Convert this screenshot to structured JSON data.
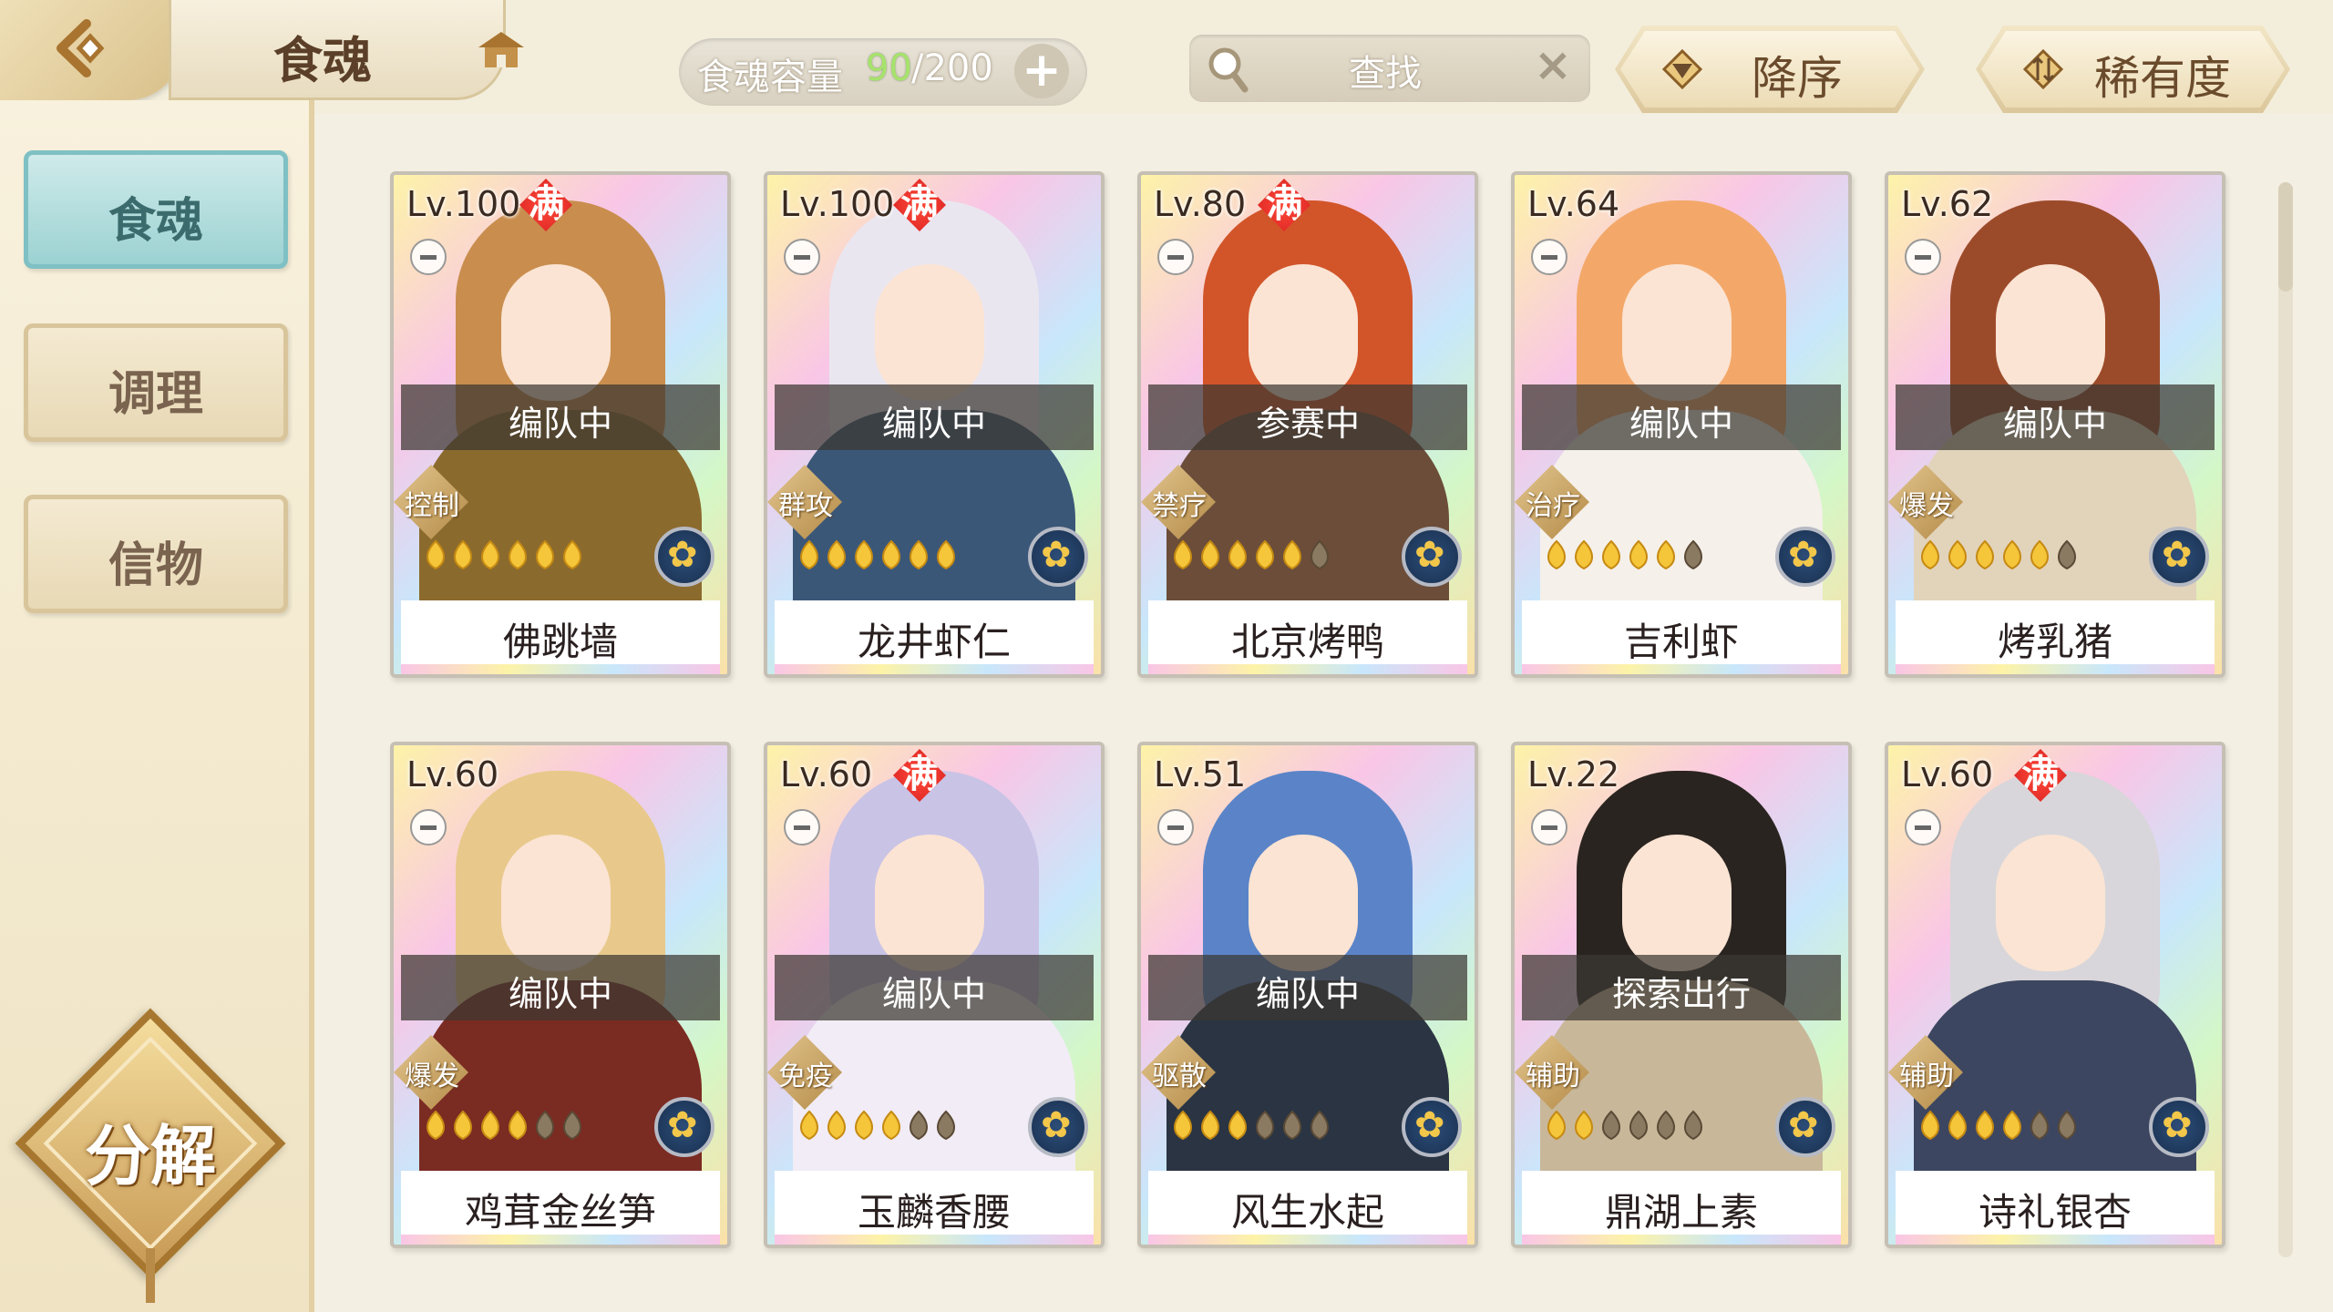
{
  "header": {
    "title": "食魂",
    "capacity_label": "食魂容量",
    "capacity_count": "90",
    "capacity_max": "/200",
    "capacity_add": "+",
    "search_placeholder": "查找",
    "search_clear": "×",
    "sort_order_label": "降序",
    "sort_field_label": "稀有度"
  },
  "sidebar": {
    "tabs": [
      {
        "label": "食魂",
        "active": true
      },
      {
        "label": "调理",
        "active": false
      },
      {
        "label": "信物",
        "active": false
      }
    ],
    "decompose_label": "分解"
  },
  "cards": [
    {
      "level": "Lv.100",
      "full": "满",
      "status": "编队中",
      "role": "控制",
      "stars": 6,
      "name": "佛跳墙",
      "hair": "#c98d4e",
      "robe": "#8b6a2e"
    },
    {
      "level": "Lv.100",
      "full": "满",
      "status": "编队中",
      "role": "群攻",
      "stars": 6,
      "name": "龙井虾仁",
      "hair": "#eae6f0",
      "robe": "#3b5778"
    },
    {
      "level": "Lv.80",
      "full": "满",
      "status": "参赛中",
      "role": "禁疗",
      "stars": 5,
      "name": "北京烤鸭",
      "hair": "#d2552a",
      "robe": "#6b4d3a"
    },
    {
      "level": "Lv.64",
      "full": "",
      "status": "编队中",
      "role": "治疗",
      "stars": 5,
      "name": "吉利虾",
      "hair": "#f3a86a",
      "robe": "#f5f0ea"
    },
    {
      "level": "Lv.62",
      "full": "",
      "status": "编队中",
      "role": "爆发",
      "stars": 5,
      "name": "烤乳猪",
      "hair": "#9c4b2a",
      "robe": "#e2d3bb"
    },
    {
      "level": "Lv.60",
      "full": "",
      "status": "编队中",
      "role": "爆发",
      "stars": 4,
      "name": "鸡茸金丝笋",
      "hair": "#e8c98b",
      "robe": "#7a2b22"
    },
    {
      "level": "Lv.60",
      "full": "满",
      "status": "编队中",
      "role": "免疫",
      "stars": 4,
      "name": "玉麟香腰",
      "hair": "#c9c3e6",
      "robe": "#f1ecf5"
    },
    {
      "level": "Lv.51",
      "full": "",
      "status": "编队中",
      "role": "驱散",
      "stars": 3,
      "name": "风生水起",
      "hair": "#5b84c8",
      "robe": "#2a3442"
    },
    {
      "level": "Lv.22",
      "full": "",
      "status": "探索出行",
      "role": "辅助",
      "stars": 2,
      "name": "鼎湖上素",
      "hair": "#2a2420",
      "robe": "#c9b79a"
    },
    {
      "level": "Lv.60",
      "full": "满",
      "status": "",
      "role": "辅助",
      "stars": 4,
      "name": "诗礼银杏",
      "hair": "#d8d6da",
      "robe": "#3d4660"
    }
  ],
  "colors": {
    "capacity_count": "#a6e36b",
    "active_tab": "#9cd2d2",
    "full_badge": "#d61f1f"
  }
}
